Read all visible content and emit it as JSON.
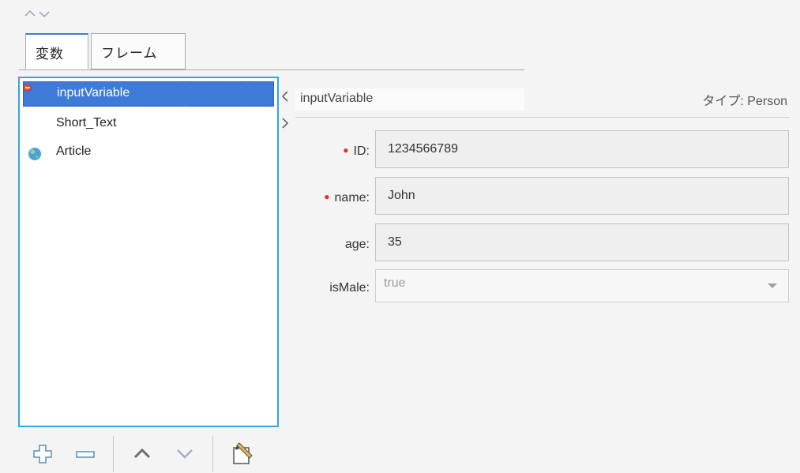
{
  "tabs": [
    {
      "label": "変数",
      "active": true
    },
    {
      "label": "フレーム",
      "active": false
    }
  ],
  "variables": [
    {
      "name": "inputVariable",
      "icon": "input-variable-icon",
      "selected": true
    },
    {
      "name": "Short_Text",
      "icon": "none",
      "selected": false
    },
    {
      "name": "Article",
      "icon": "globe-icon",
      "selected": false
    }
  ],
  "detail": {
    "title": "inputVariable",
    "type_text": "タイプ: Person",
    "fields": [
      {
        "label": "ID:",
        "required": true,
        "value": "1234566789"
      },
      {
        "label": "name:",
        "required": true,
        "value": "John"
      },
      {
        "label": "age:",
        "required": false,
        "value": "35"
      }
    ],
    "select": {
      "label": "isMale:",
      "value": "true"
    }
  },
  "toolbar": {
    "buttons": [
      "add-icon",
      "remove-icon",
      "move-up-icon",
      "move-down-icon",
      "edit-note-icon"
    ]
  },
  "colors": {
    "selection": "#3e7ad8",
    "list_border": "#34a6d8",
    "required_marker": "#e03030"
  }
}
